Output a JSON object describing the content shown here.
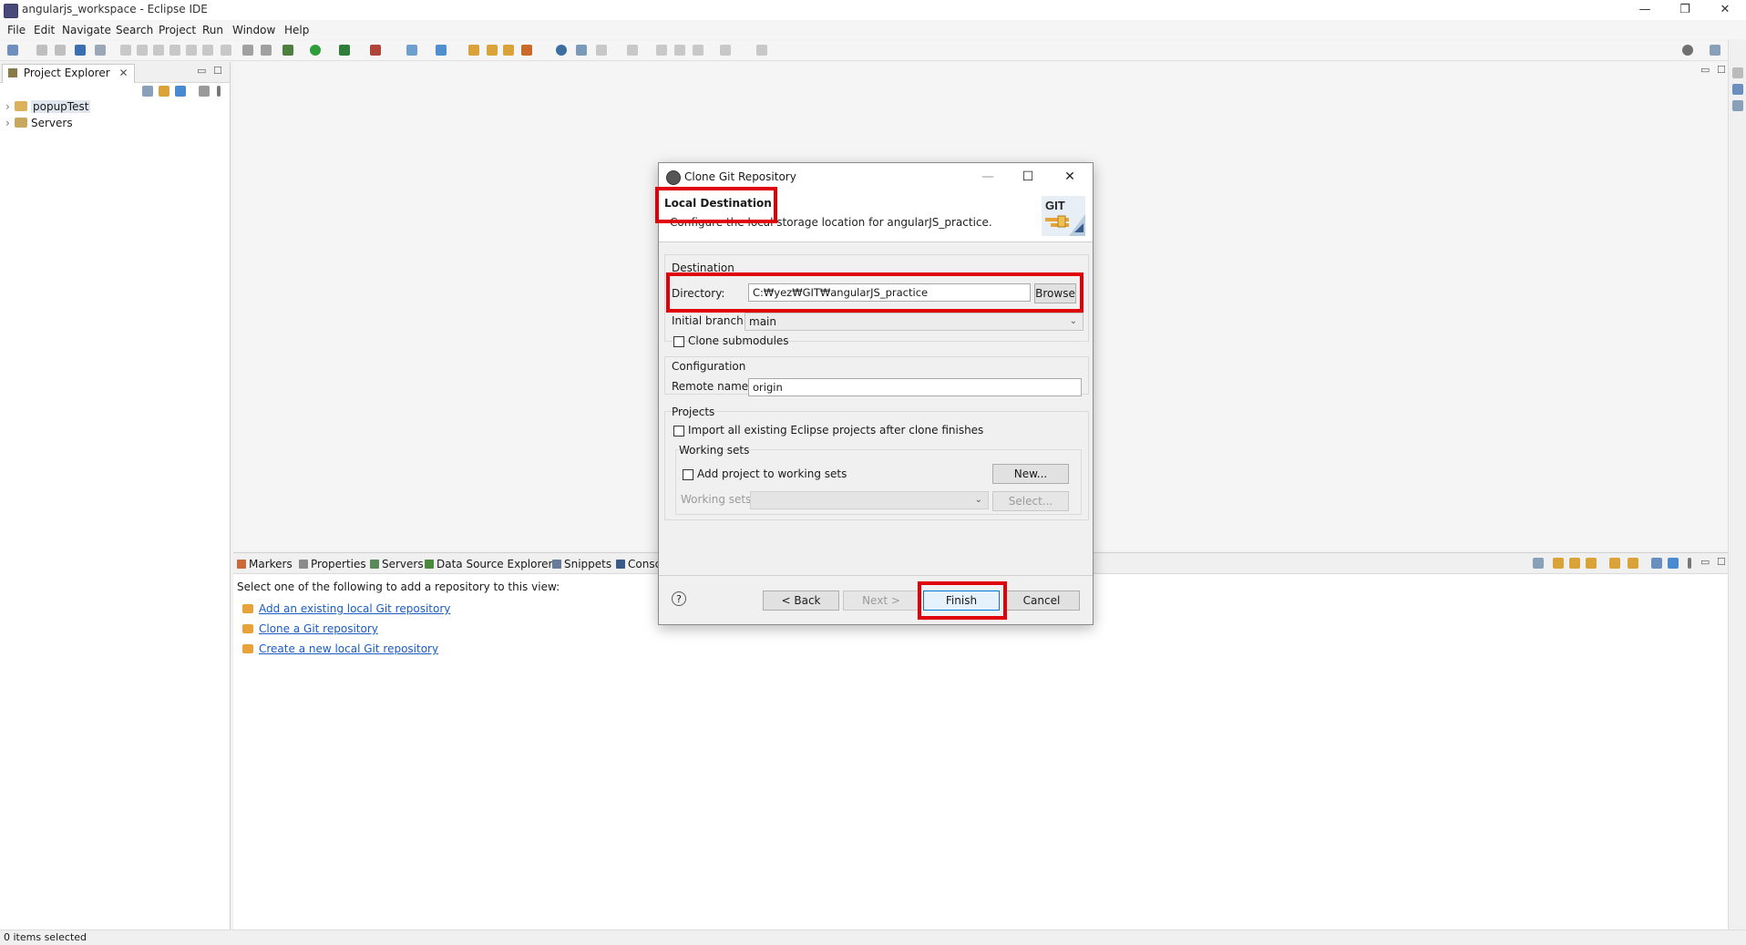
{
  "window": {
    "title": "angularjs_workspace - Eclipse IDE",
    "minimize": "—",
    "restore": "❐",
    "close": "✕"
  },
  "menu": [
    "File",
    "Edit",
    "Navigate",
    "Search",
    "Project",
    "Run",
    "Window",
    "Help"
  ],
  "project_explorer": {
    "tab_label": "Project Explorer",
    "tab_close": "✕",
    "tree": [
      {
        "label": "popupTest",
        "arrow": "›"
      },
      {
        "label": "Servers",
        "arrow": "›"
      }
    ]
  },
  "bottom_views": {
    "tabs": [
      "Markers",
      "Properties",
      "Servers",
      "Data Source Explorer",
      "Snippets",
      "Consc"
    ],
    "prompt": "Select one of the following to add a repository to this view:",
    "links": [
      "Add an existing local Git repository",
      "Clone a Git repository",
      "Create a new local Git repository"
    ]
  },
  "status": {
    "text": "0 items selected"
  },
  "dialog": {
    "title": "Clone Git Repository",
    "minimize": "—",
    "maximize": "☐",
    "close": "✕",
    "page_title": "Local Destination",
    "page_desc": "Configure the local storage location for angularJS_practice.",
    "logo_text": "GIT",
    "destination": {
      "group_label": "Destination",
      "directory_label": "Directory:",
      "directory_value": "C:₩yez₩GIT₩angularJS_practice",
      "browse_label": "Browse",
      "initial_branch_label": "Initial branch:",
      "initial_branch_value": "main",
      "clone_submodules_label": "Clone submodules"
    },
    "configuration": {
      "group_label": "Configuration",
      "remote_name_label": "Remote name:",
      "remote_name_value": "origin"
    },
    "projects": {
      "group_label": "Projects",
      "import_label": "Import all existing Eclipse projects after clone finishes",
      "working_sets_group": "Working sets",
      "add_to_ws_label": "Add project to working sets",
      "new_label": "New...",
      "working_sets_label": "Working sets:",
      "select_label": "Select..."
    },
    "buttons": {
      "help": "?",
      "back": "< Back",
      "next": "Next >",
      "finish": "Finish",
      "cancel": "Cancel"
    }
  },
  "colors": {
    "highlight": "#e0000a",
    "link": "#1a5bc4"
  }
}
